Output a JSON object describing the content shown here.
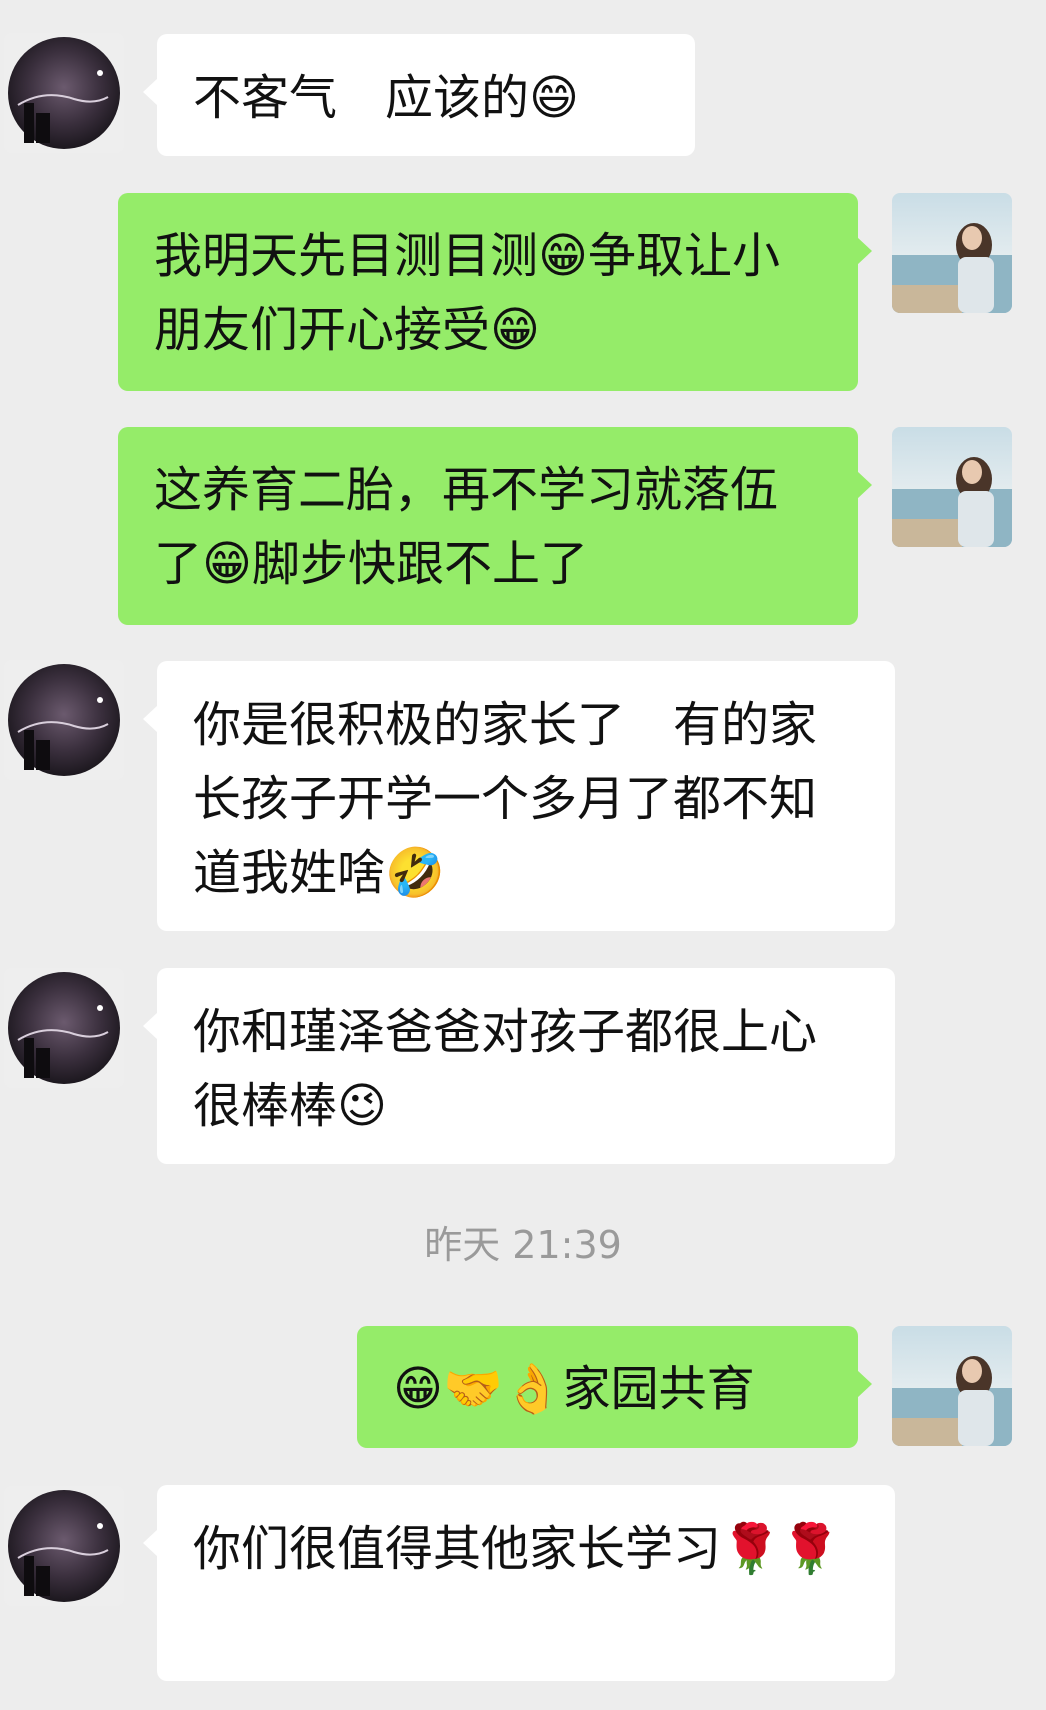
{
  "messages": [
    {
      "from": "contact",
      "text": "不客气　应该的😄"
    },
    {
      "from": "me",
      "text": "我明天先目测目测😁争取让小朋友们开心接受😁"
    },
    {
      "from": "me",
      "text": "这养育二胎，再不学习就落伍了😁脚步快跟不上了"
    },
    {
      "from": "contact",
      "text": "你是很积极的家长了　有的家长孩子开学一个多月了都不知道我姓啥🤣"
    },
    {
      "from": "contact",
      "text": "你和瑾泽爸爸对孩子都很上心　　很棒棒😉"
    },
    {
      "from": "me",
      "text": "😁🤝👌家园共育"
    },
    {
      "from": "contact",
      "text": "你们很值得其他家长学习🌹🌹"
    }
  ],
  "timestamp": "昨天 21:39",
  "colors": {
    "background": "#ededed",
    "incoming_bubble": "#ffffff",
    "outgoing_bubble": "#95ec69",
    "timestamp_text": "#9a9a9a"
  },
  "icons": {
    "contact_avatar": "night-sky-avatar-icon",
    "my_avatar": "beach-photo-avatar-icon"
  }
}
